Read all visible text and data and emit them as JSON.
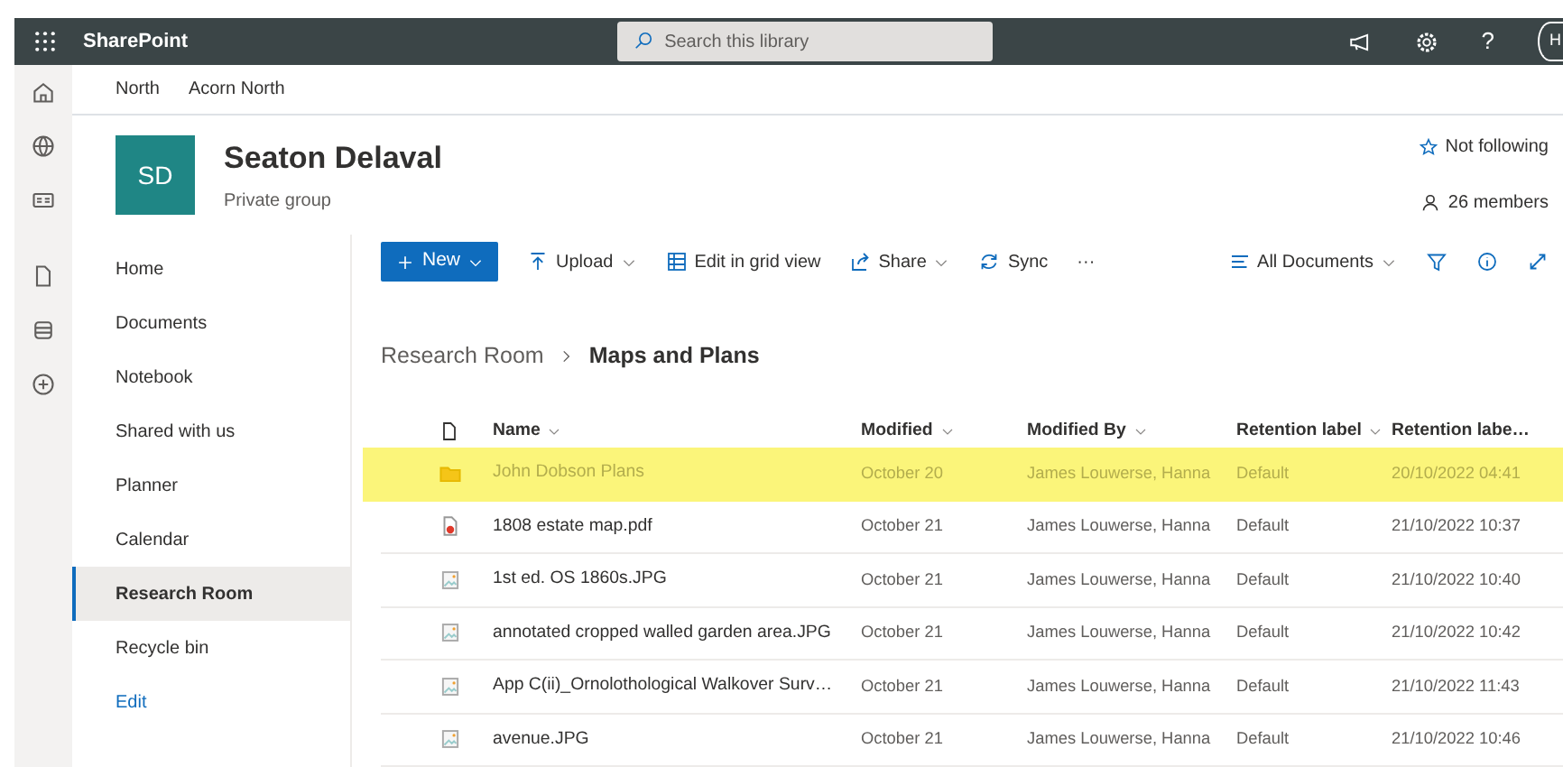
{
  "app_bar": {
    "app_name": "SharePoint",
    "search_placeholder": "Search this library",
    "help": "?",
    "avatar": "H"
  },
  "site_nav": [
    "North",
    "Acorn North"
  ],
  "site": {
    "initials": "SD",
    "title": "Seaton Delaval",
    "subtitle": "Private group",
    "follow": "Not following",
    "members": "26 members"
  },
  "left_nav": [
    {
      "label": "Home",
      "selected": false
    },
    {
      "label": "Documents",
      "selected": false
    },
    {
      "label": "Notebook",
      "selected": false
    },
    {
      "label": "Shared with us",
      "selected": false
    },
    {
      "label": "Planner",
      "selected": false
    },
    {
      "label": "Calendar",
      "selected": false
    },
    {
      "label": "Research Room",
      "selected": true
    },
    {
      "label": "Recycle bin",
      "selected": false
    }
  ],
  "edit_link": "Edit",
  "command_bar": {
    "new": "New",
    "upload": "Upload",
    "grid": "Edit in grid view",
    "share": "Share",
    "sync": "Sync",
    "more": "···",
    "view": "All Documents"
  },
  "breadcrumb": {
    "parent": "Research Room",
    "current": "Maps and Plans"
  },
  "table": {
    "columns": [
      "Name",
      "Modified",
      "Modified By",
      "Retention label",
      "Retention labe…"
    ],
    "rows": [
      {
        "kind": "folder",
        "name": "John Dobson Plans",
        "modified": "October 20",
        "modified_by": "James Louwerse, Hanna",
        "retention_label": "Default",
        "column_5": "20/10/2022 04:41",
        "highlighted": true
      },
      {
        "kind": "pdf",
        "name": "1808 estate map.pdf",
        "modified": "October 21",
        "modified_by": "James Louwerse, Hanna",
        "retention_label": "Default",
        "column_5": "21/10/2022 10:37",
        "highlighted": false
      },
      {
        "kind": "image",
        "name": "1st ed. OS 1860s.JPG",
        "modified": "October 21",
        "modified_by": "James Louwerse, Hanna",
        "retention_label": "Default",
        "column_5": "21/10/2022 10:40",
        "highlighted": false
      },
      {
        "kind": "image",
        "name": "annotated cropped walled garden area.JPG",
        "modified": "October 21",
        "modified_by": "James Louwerse, Hanna",
        "retention_label": "Default",
        "column_5": "21/10/2022 10:42",
        "highlighted": false
      },
      {
        "kind": "image",
        "name": "App C(ii)_Ornolothological Walkover Surv…",
        "modified": "October 21",
        "modified_by": "James Louwerse, Hanna",
        "retention_label": "Default",
        "column_5": "21/10/2022 11:43",
        "highlighted": false
      },
      {
        "kind": "image",
        "name": "avenue.JPG",
        "modified": "October 21",
        "modified_by": "James Louwerse, Hanna",
        "retention_label": "Default",
        "column_5": "21/10/2022 10:46",
        "highlighted": false
      }
    ]
  }
}
